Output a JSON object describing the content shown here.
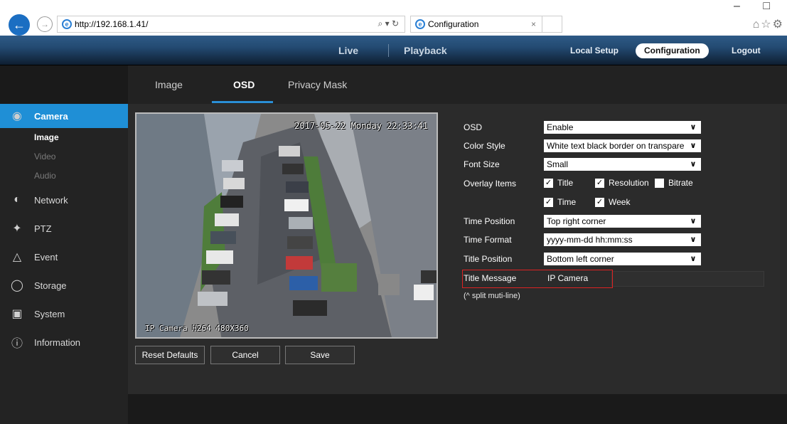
{
  "browser": {
    "url": "http://192.168.1.41/",
    "addr_tools": "⌕ ▾ ↻",
    "tab_title": "Configuration",
    "tab_close": "×",
    "window_controls": "– □",
    "fav_icons": "⌂☆⚙",
    "icons": [
      "back-icon",
      "forward-icon",
      "ie-icon",
      "search-icon",
      "refresh-icon",
      "home-icon",
      "star-icon",
      "gear-icon"
    ]
  },
  "topnav": {
    "live": "Live",
    "playback": "Playback",
    "local_setup": "Local Setup",
    "configuration": "Configuration",
    "logout": "Logout"
  },
  "sidebar": {
    "camera": "Camera",
    "sub": [
      "Image",
      "Video",
      "Audio"
    ],
    "network": "Network",
    "ptz": "PTZ",
    "event": "Event",
    "storage": "Storage",
    "system": "System",
    "information": "Information"
  },
  "tabs": {
    "image": "Image",
    "osd": "OSD",
    "privacy": "Privacy Mask"
  },
  "video": {
    "timestamp": "2017-05-22 Monday 22:33:41",
    "caption": "IP Camera H264 480X360"
  },
  "buttons": {
    "reset": "Reset Defaults",
    "cancel": "Cancel",
    "save": "Save"
  },
  "form": {
    "osd_label": "OSD",
    "osd_value": "Enable",
    "color_label": "Color Style",
    "color_value": "White text black border on transpare",
    "font_label": "Font Size",
    "font_value": "Small",
    "overlay_label": "Overlay Items",
    "overlay": [
      {
        "label": "Title",
        "checked": true
      },
      {
        "label": "Resolution",
        "checked": true
      },
      {
        "label": "Bitrate",
        "checked": false
      },
      {
        "label": "Time",
        "checked": true
      },
      {
        "label": "Week",
        "checked": true
      }
    ],
    "time_pos_label": "Time Position",
    "time_pos_value": "Top right corner",
    "time_fmt_label": "Time Format",
    "time_fmt_value": "yyyy-mm-dd hh:mm:ss",
    "title_pos_label": "Title Position",
    "title_pos_value": "Bottom left corner",
    "title_msg_label": "Title Message",
    "title_msg_value": "IP Camera",
    "split_note": "(^ split muti-line)"
  },
  "colors": {
    "accent": "#1f8fd6",
    "highlight_border": "#dd2222"
  }
}
